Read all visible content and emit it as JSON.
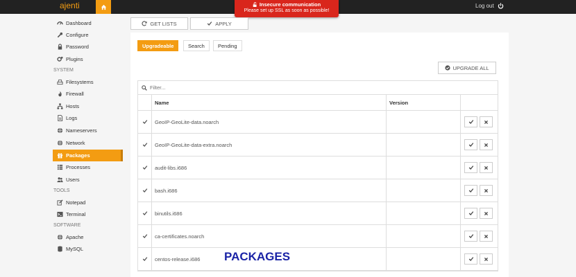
{
  "app": {
    "brand": "ajenti",
    "logout_label": "Log out"
  },
  "alert": {
    "title": "Insecure communication",
    "message": "Please set up SSL as soon as possible!"
  },
  "sidebar": {
    "items": [
      {
        "label": "Dashboard",
        "icon": "dashboard-icon"
      },
      {
        "label": "Configure",
        "icon": "wrench-icon"
      },
      {
        "label": "Password",
        "icon": "lock-icon"
      },
      {
        "label": "Plugins",
        "icon": "cogs-icon"
      }
    ],
    "system_label": "SYSTEM",
    "system_items": [
      {
        "label": "Filesystems",
        "icon": "hdd-icon"
      },
      {
        "label": "Firewall",
        "icon": "fire-icon"
      },
      {
        "label": "Hosts",
        "icon": "sitemap-icon"
      },
      {
        "label": "Logs",
        "icon": "file-icon"
      },
      {
        "label": "Nameservers",
        "icon": "globe-icon"
      },
      {
        "label": "Network",
        "icon": "globe-icon"
      },
      {
        "label": "Packages",
        "icon": "gift-icon"
      },
      {
        "label": "Processes",
        "icon": "list-icon"
      },
      {
        "label": "Users",
        "icon": "users-icon"
      }
    ],
    "tools_label": "TOOLS",
    "tools_items": [
      {
        "label": "Notepad",
        "icon": "edit-icon"
      },
      {
        "label": "Terminal",
        "icon": "terminal-icon"
      }
    ],
    "software_label": "SOFTWARE",
    "software_items": [
      {
        "label": "Apache",
        "icon": "globe-icon"
      },
      {
        "label": "MySQL",
        "icon": "database-icon"
      }
    ]
  },
  "toolbar": {
    "get_lists_label": "GET LISTS",
    "apply_label": "APPLY"
  },
  "tabs": [
    "Upgradeable",
    "Search",
    "Pending"
  ],
  "upgrade_all_label": "UPGRADE ALL",
  "filter": {
    "placeholder": "Filter..."
  },
  "table": {
    "columns": [
      "Name",
      "Version"
    ],
    "rows": [
      {
        "name": "GeoIP-GeoLite-data.noarch",
        "version": ""
      },
      {
        "name": "GeoIP-GeoLite-data-extra.noarch",
        "version": ""
      },
      {
        "name": "audit-libs.i686",
        "version": ""
      },
      {
        "name": "bash.i686",
        "version": ""
      },
      {
        "name": "binutils.i686",
        "version": ""
      },
      {
        "name": "ca-certificates.noarch",
        "version": ""
      },
      {
        "name": "centos-release.i686",
        "version": ""
      }
    ]
  },
  "overlay_title": "PACKAGES",
  "colors": {
    "accent": "#f39c12",
    "alert": "#d9261c",
    "overlay": "#1a23a6"
  }
}
